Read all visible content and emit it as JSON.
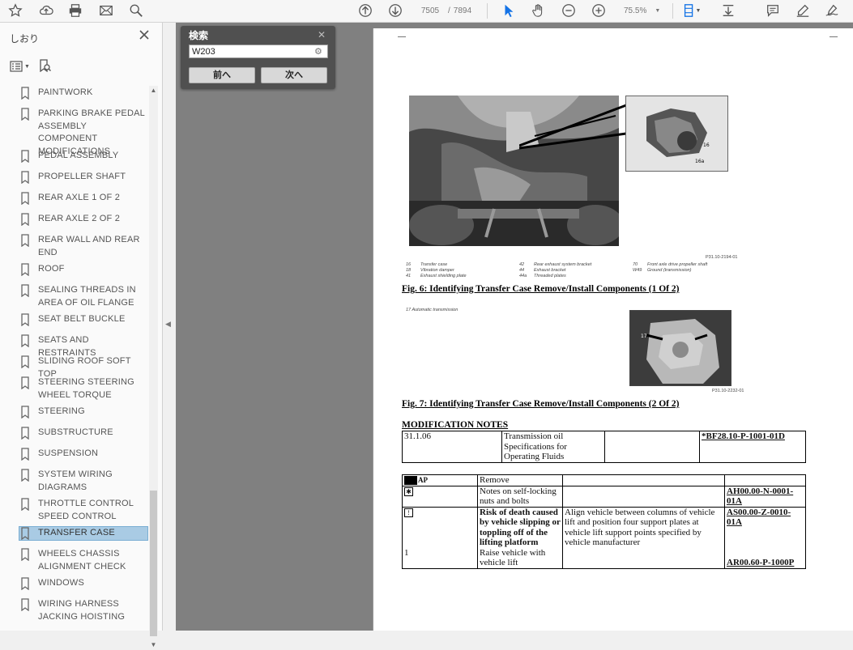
{
  "toolbar": {
    "page_current": "7505",
    "page_separator": "/",
    "page_total": "7894",
    "zoom": "75.5%"
  },
  "bookmarks": {
    "title": "しおり",
    "items": [
      {
        "label": "PAINTWORK"
      },
      {
        "label": "PARKING BRAKE PEDAL ASSEMBLY COMPONENT MODIFICATIONS"
      },
      {
        "label": "PEDAL ASSEMBLY"
      },
      {
        "label": "PROPELLER SHAFT"
      },
      {
        "label": "REAR AXLE 1 OF 2"
      },
      {
        "label": "REAR AXLE 2 OF 2"
      },
      {
        "label": "REAR WALL AND REAR END"
      },
      {
        "label": "ROOF"
      },
      {
        "label": "SEALING THREADS IN AREA OF OIL FLANGE"
      },
      {
        "label": "SEAT BELT BUCKLE"
      },
      {
        "label": "SEATS AND RESTRAINTS"
      },
      {
        "label": "SLIDING ROOF SOFT TOP"
      },
      {
        "label": "STEERING STEERING WHEEL TORQUE"
      },
      {
        "label": "STEERING"
      },
      {
        "label": "SUBSTRUCTURE"
      },
      {
        "label": "SUSPENSION"
      },
      {
        "label": "SYSTEM WIRING DIAGRAMS"
      },
      {
        "label": "THROTTLE CONTROL SPEED CONTROL"
      },
      {
        "label": "TRANSFER CASE"
      },
      {
        "label": "WHEELS CHASSIS ALIGNMENT CHECK"
      },
      {
        "label": "WINDOWS"
      },
      {
        "label": "WIRING HARNESS JACKING HOISTING"
      }
    ]
  },
  "find": {
    "title": "検索",
    "query": "W203",
    "prev_label": "前へ",
    "next_label": "次へ"
  },
  "document": {
    "fig6_code": "P31.10-2194-01",
    "fig6_legend": [
      [
        "16",
        "Transfer case"
      ],
      [
        "42",
        "Rear exhaust system bracket"
      ],
      [
        "70",
        "Front axle drive propeller shaft"
      ],
      [
        "18",
        "Vibration damper"
      ],
      [
        "44",
        "Exhaust bracket"
      ],
      [
        "W49",
        "Ground (transmission)"
      ],
      [
        "41",
        "Exhaust shielding plate"
      ],
      [
        "44a",
        "Threaded plates"
      ],
      [
        "",
        ""
      ]
    ],
    "fig6_caption": "Fig. 6: Identifying Transfer Case Remove/Install Components (1 Of 2)",
    "fig7_legend": "17  Automatic transmission",
    "fig7_code": "P31.10-2232-01",
    "fig7_caption": "Fig. 7: Identifying Transfer Case Remove/Install Components (2 Of 2)",
    "notes_heading": "MODIFICATION NOTES",
    "notes_row": {
      "date": "31.1.06",
      "text": "Transmission oil Specifications for Operating Fluids",
      "blank": "",
      "ref": "*BF28.10-P-1001-01D"
    },
    "table_header": {
      "icon_label": "AP",
      "col1": "Remove"
    },
    "table_rows": [
      {
        "step": "",
        "action": "Notes on self-locking nuts and bolts",
        "detail": "",
        "ref": "AH00.00-N-0001-01A"
      },
      {
        "step": "",
        "action": "Risk of death caused by vehicle slipping or toppling off of the lifting platform",
        "detail": "Align vehicle between columns of vehicle lift and position four support plates at vehicle lift support points specified by vehicle manufacturer",
        "ref": "AS00.00-Z-0010-01A"
      },
      {
        "step": "1",
        "action": "Raise vehicle with vehicle lift",
        "detail": "",
        "ref": "AR00.60-P-1000P"
      }
    ]
  }
}
